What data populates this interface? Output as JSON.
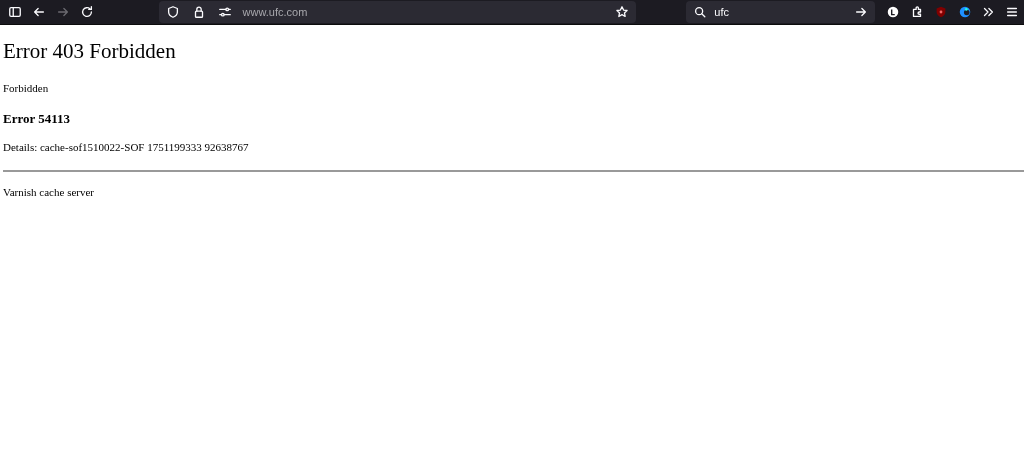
{
  "toolbar": {
    "back_disabled": false,
    "forward_disabled": true,
    "url": "www.ufc.com",
    "search": {
      "value": "ufc"
    }
  },
  "page": {
    "title": "Error 403 Forbidden",
    "message": "Forbidden",
    "error_heading": "Error 54113",
    "details": "Details: cache-sof1510022-SOF 1751199333 92638767",
    "footer": "Varnish cache server"
  }
}
